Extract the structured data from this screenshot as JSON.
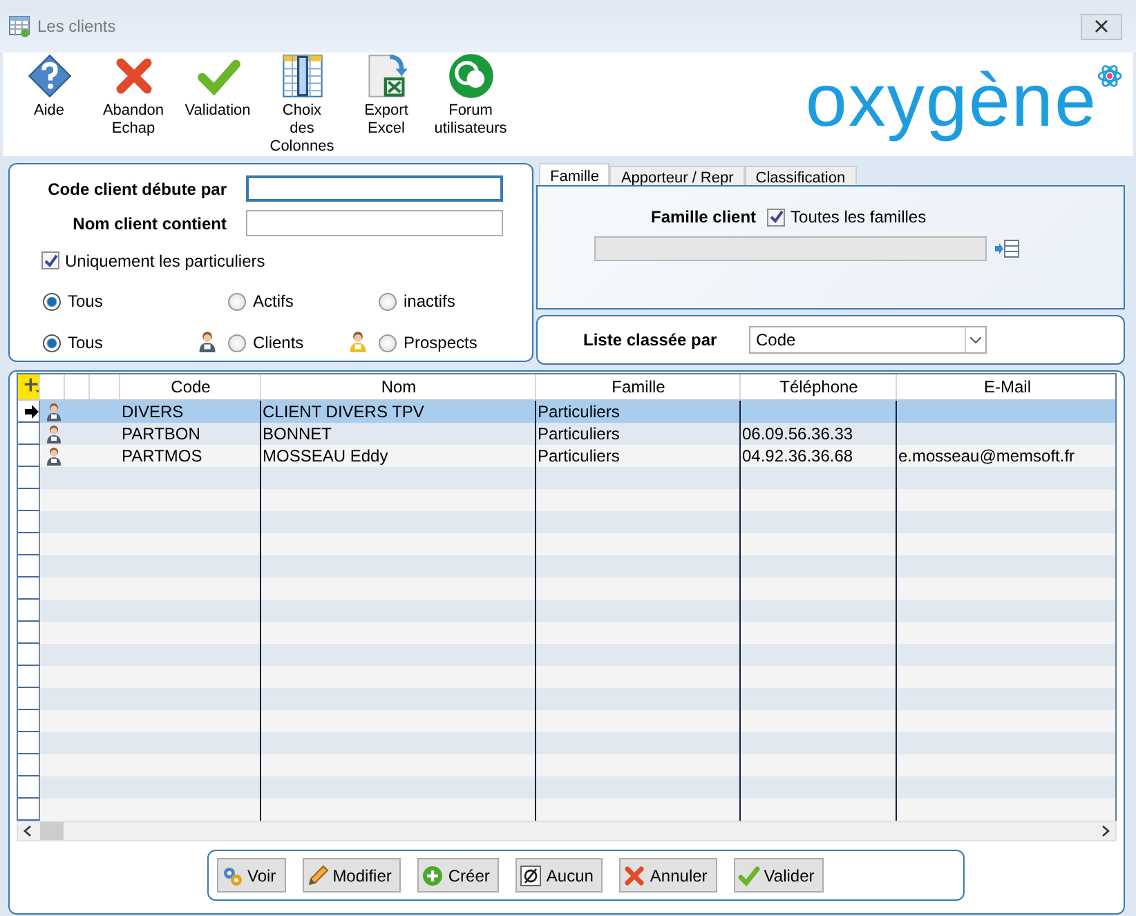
{
  "window": {
    "title": "Les clients"
  },
  "toolbar": [
    {
      "label": "Aide"
    },
    {
      "label": "Abandon\nEchap"
    },
    {
      "label": "Validation"
    },
    {
      "label": "Choix\ndes\nColonnes"
    },
    {
      "label": "Export\nExcel"
    },
    {
      "label": "Forum\nutilisateurs"
    }
  ],
  "logo": "oxygène",
  "filters": {
    "code_label": "Code client débute par",
    "name_label": "Nom client contient",
    "only_private": {
      "label": "Uniquement les particuliers",
      "checked": true
    },
    "status": [
      {
        "label": "Tous",
        "selected": true
      },
      {
        "label": "Actifs",
        "selected": false
      },
      {
        "label": "inactifs",
        "selected": false
      }
    ],
    "type": [
      {
        "label": "Tous",
        "selected": true,
        "kind": "all"
      },
      {
        "label": "Clients",
        "selected": false,
        "kind": "client"
      },
      {
        "label": "Prospects",
        "selected": false,
        "kind": "prospect"
      }
    ]
  },
  "tabs": [
    {
      "label": "Famille",
      "selected": true
    },
    {
      "label": "Apporteur / Repr",
      "selected": false
    },
    {
      "label": "Classification",
      "selected": false
    }
  ],
  "family": {
    "label": "Famille client",
    "all": {
      "label": "Toutes les familles",
      "checked": true
    }
  },
  "sort": {
    "label": "Liste classée par",
    "value": "Code"
  },
  "table": {
    "columns": [
      "Code",
      "Nom",
      "Famille",
      "Téléphone",
      "E-Mail"
    ],
    "rows": [
      {
        "selected": true,
        "cells": [
          "DIVERS",
          "CLIENT DIVERS TPV",
          "Particuliers",
          "",
          ""
        ]
      },
      {
        "selected": false,
        "cells": [
          "PARTBON",
          "BONNET",
          "Particuliers",
          "06.09.56.36.33",
          ""
        ]
      },
      {
        "selected": false,
        "cells": [
          "PARTMOS",
          "MOSSEAU Eddy",
          "Particuliers",
          "04.92.36.36.68",
          "e.mosseau@memsoft.fr"
        ]
      }
    ]
  },
  "buttons": [
    {
      "label": "Voir"
    },
    {
      "label": "Modifier"
    },
    {
      "label": "Créer"
    },
    {
      "label": "Aucun"
    },
    {
      "label": "Annuler"
    },
    {
      "label": "Valider"
    }
  ]
}
